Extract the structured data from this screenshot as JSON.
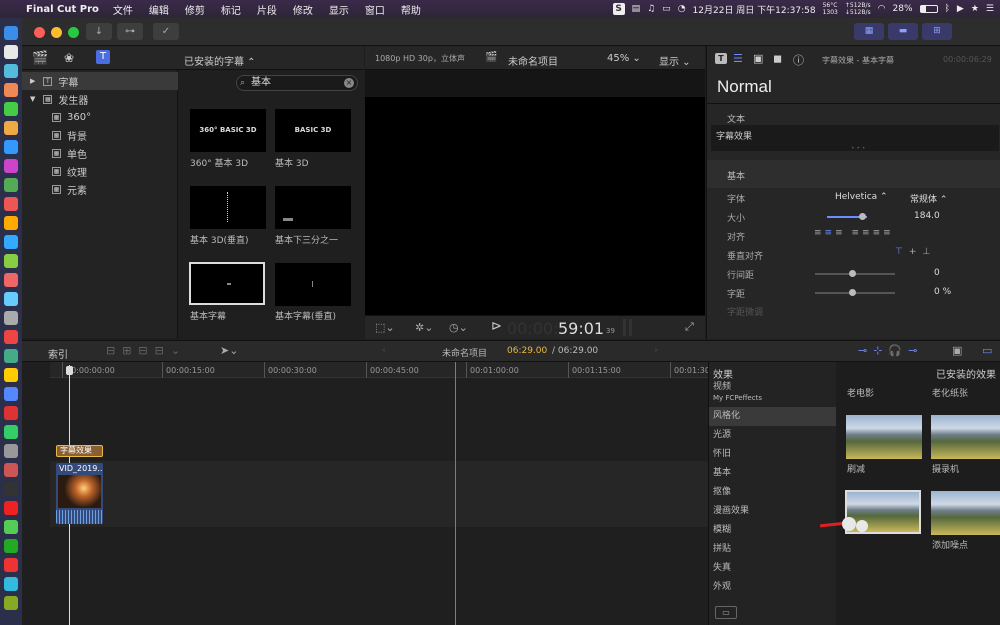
{
  "menubar": {
    "app_name": "Final Cut Pro",
    "items": [
      "文件",
      "编辑",
      "修剪",
      "标记",
      "片段",
      "修改",
      "显示",
      "窗口",
      "帮助"
    ],
    "cpu_temp": "56°C",
    "cpu_rpm": "1303",
    "net_up": "↑512B/s",
    "net_down": "↓512B/s",
    "battery": "28%",
    "datetime": "12月22日 周日 下午12:37:58"
  },
  "library": {
    "dropdown_label": "已安装的字幕 ⌃",
    "search_value": "基本",
    "sidebar": [
      {
        "label": "字幕",
        "level": 0
      },
      {
        "label": "发生器",
        "level": 0
      },
      {
        "label": "360°",
        "level": 1
      },
      {
        "label": "背景",
        "level": 1
      },
      {
        "label": "单色",
        "level": 1
      },
      {
        "label": "纹理",
        "level": 1
      },
      {
        "label": "元素",
        "level": 1
      }
    ],
    "thumbs": [
      {
        "label": "360° 基本 3D",
        "preview": "360° BASIC 3D"
      },
      {
        "label": "基本 3D",
        "preview": "BASIC 3D"
      },
      {
        "label": "基本 3D(垂直)",
        "preview": ""
      },
      {
        "label": "基本下三分之一",
        "preview": ""
      },
      {
        "label": "基本字幕",
        "preview": ""
      },
      {
        "label": "基本字幕(垂直)",
        "preview": ""
      }
    ]
  },
  "viewer": {
    "format": "1080p HD 30p，立体声",
    "project_name": "未命名项目",
    "zoom": "45% ⌄",
    "display": "显示 ⌄",
    "timecode_dim": "00:00:",
    "timecode": "59:01",
    "frames": "39"
  },
  "inspector": {
    "header_title": "字幕效果 - 基本字幕",
    "header_time": "00:00:06:29",
    "title": "Normal",
    "text_section": "文本",
    "text_value": "字幕效果",
    "basic_section": "基本",
    "font_label": "字体",
    "font_value": "Helvetica ⌃",
    "style_value": "常规体 ⌃",
    "size_label": "大小",
    "size_value": "184.0",
    "align_label": "对齐",
    "valign_label": "垂直对齐",
    "linespace_label": "行间距",
    "linespace_value": "0",
    "tracking_label": "字距",
    "tracking_value": "0 %",
    "extra_label": "字距微调"
  },
  "timeline": {
    "index_label": "索引",
    "project_name": "未命名项目",
    "position": "06:29.00",
    "duration": "/ 06:29.00",
    "ticks": [
      "00:00:00:00",
      "00:00:15:00",
      "00:00:30:00",
      "00:00:45:00",
      "00:01:00:00",
      "00:01:15:00",
      "00:01:30"
    ],
    "title_clip": "字幕效果",
    "video_clip": "VID_2019..."
  },
  "effects": {
    "header": "效果",
    "installed_header": "已安装的效果",
    "categories": [
      "视频",
      "My FCPeffects",
      "风格化",
      "光源",
      "怀旧",
      "基本",
      "抠像",
      "漫画效果",
      "模糊",
      "拼贴",
      "失真",
      "外观"
    ],
    "selected_index": 2,
    "thumbs": [
      "老电影",
      "老化纸张",
      "刷减",
      "摄录机",
      "",
      "添加噪点"
    ]
  }
}
